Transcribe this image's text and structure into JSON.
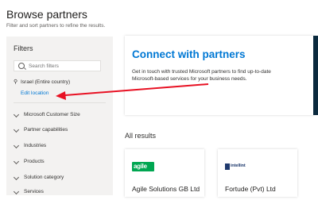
{
  "header": {
    "title": "Browse partners",
    "subtitle": "Filter and sort partners to refine the results."
  },
  "filters": {
    "title": "Filters",
    "search_placeholder": "Search filters",
    "location": "Israel (Entire country)",
    "edit_location": "Edit location",
    "items": [
      {
        "label": "Microsoft Customer Size"
      },
      {
        "label": "Partner capabilities"
      },
      {
        "label": "Industries"
      },
      {
        "label": "Products"
      },
      {
        "label": "Solution category"
      },
      {
        "label": "Services"
      }
    ]
  },
  "hero": {
    "title": "Connect with partners",
    "text": "Get in touch with trusted Microsoft partners to find up-to-date Microsoft-based services for your business needs."
  },
  "results": {
    "heading": "All results",
    "cards": [
      {
        "logo_text": "agile",
        "name": "Agile Solutions GB Ltd"
      },
      {
        "logo_text": "intellint",
        "name": "Fortude (Pvt) Ltd"
      }
    ]
  },
  "colors": {
    "accent": "#0078d4",
    "annotation_arrow": "#e81123",
    "agile_logo": "#00a651",
    "intellint_logo": "#1f3a6e"
  }
}
